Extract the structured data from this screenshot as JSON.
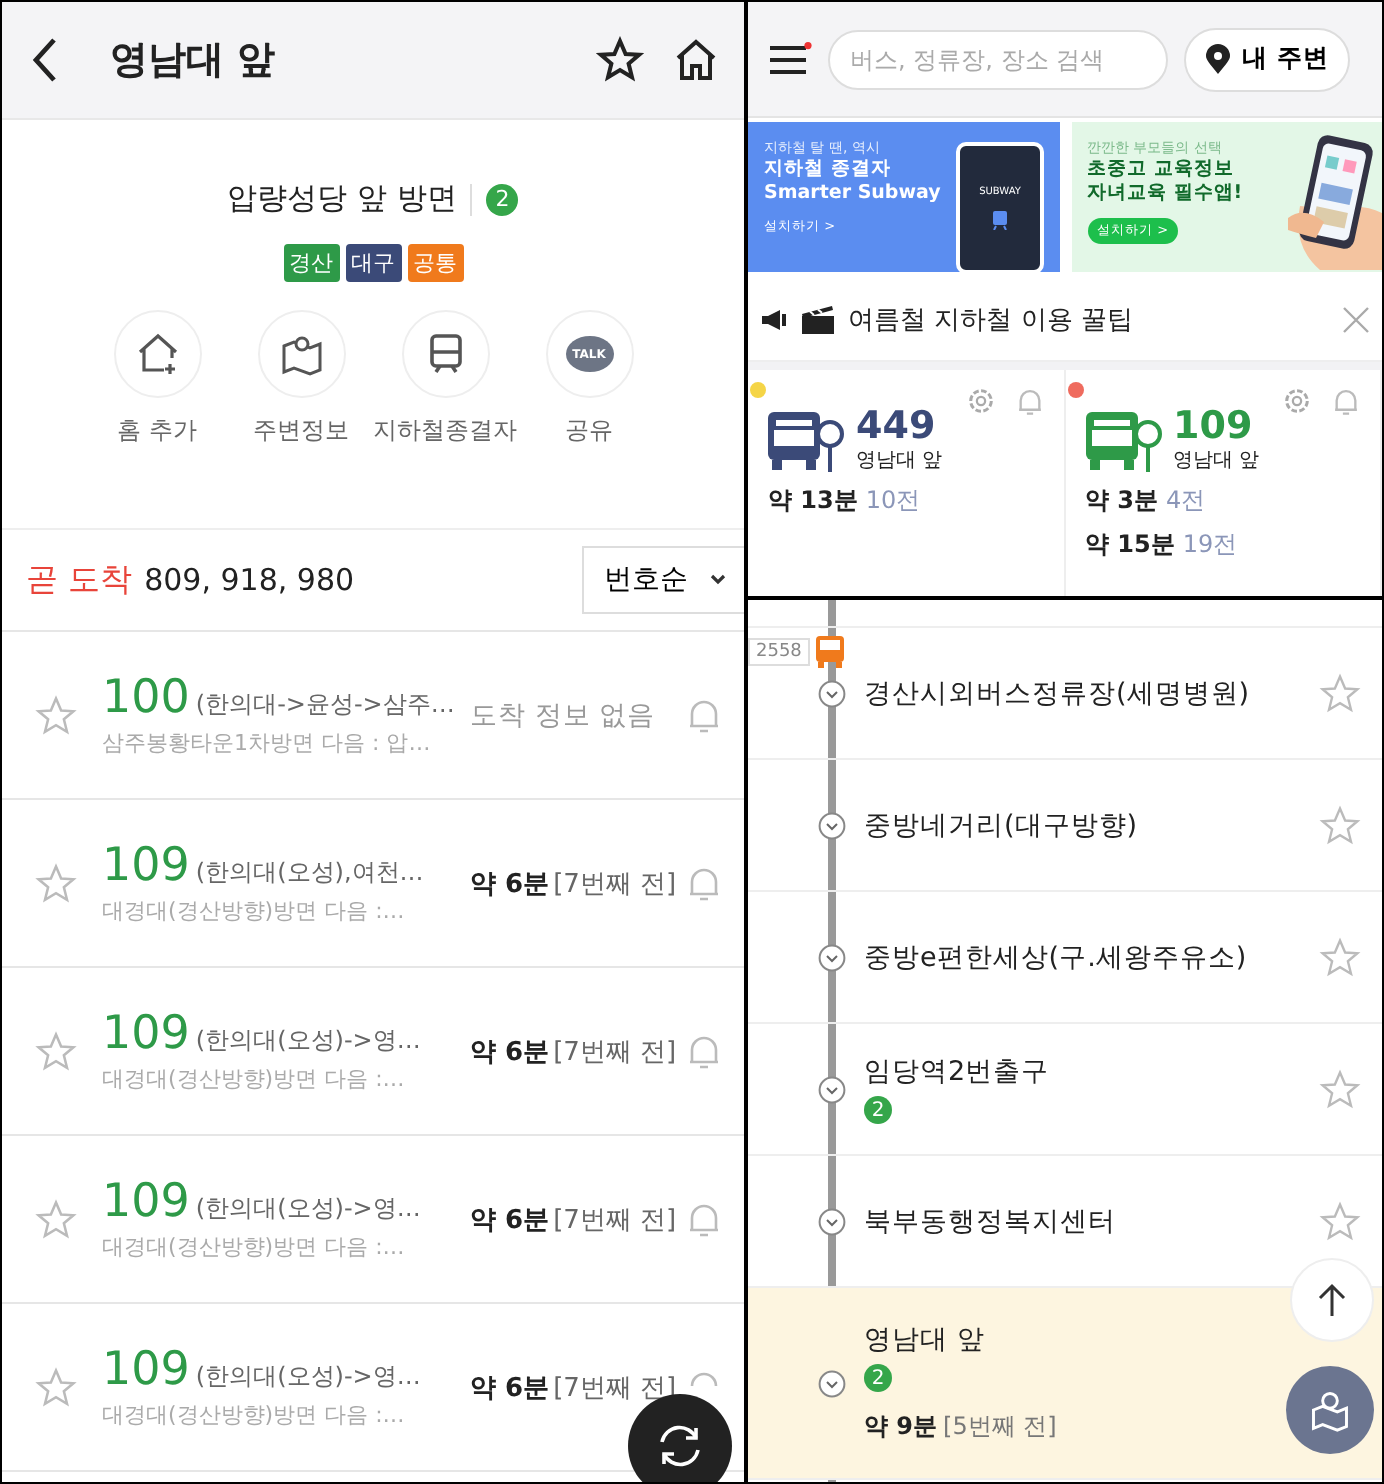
{
  "left": {
    "header": {
      "title": "영남대 앞"
    },
    "stop": {
      "direction": "압량성당 앞 방면",
      "line_badge": "2",
      "tags": [
        {
          "label": "경산",
          "color": "#2e9a48"
        },
        {
          "label": "대구",
          "color": "#3b4a78"
        },
        {
          "label": "공통",
          "color": "#f07a1c"
        }
      ]
    },
    "actions": [
      {
        "kind": "home",
        "label": "홈 추가"
      },
      {
        "kind": "map",
        "label": "주변정보"
      },
      {
        "kind": "subway",
        "label": "지하철종결자"
      },
      {
        "kind": "talk",
        "label": "공유",
        "icon_text": "TALK"
      }
    ],
    "arriving": {
      "label": "곧 도착",
      "routes": "809, 918, 980"
    },
    "sort": "번호순",
    "routes": [
      {
        "number": "100",
        "route": "(한의대->윤성->삼주…",
        "next": "삼주봉황타운1차방면 다음 : 압…",
        "status": "도착 정보 없음"
      },
      {
        "number": "109",
        "route": "(한의대(오성),여천…",
        "next": "대경대(경산방향)방면 다음 :…",
        "time": "약 6분",
        "order": "[7번째 전]"
      },
      {
        "number": "109",
        "route": "(한의대(오성)->영…",
        "next": "대경대(경산방향)방면 다음 :…",
        "time": "약 6분",
        "order": "[7번째 전]"
      },
      {
        "number": "109",
        "route": "(한의대(오성)->영…",
        "next": "대경대(경산방향)방면 다음 :…",
        "time": "약 6분",
        "order": "[7번째 전]"
      },
      {
        "number": "109",
        "route": "(한의대(오성)->영…",
        "next": "대경대(경산방향)방면 다음 :…",
        "time": "약 6분",
        "order": "[7번째 전]"
      }
    ]
  },
  "right_top": {
    "search": {
      "placeholder": "버스, 정류장, 장소 검색"
    },
    "nearby_button": "내 주변",
    "banners": [
      {
        "kind": "subway",
        "kicker": "지하철 탈 땐, 역시",
        "lines": [
          "지하철 종결자",
          "Smarter Subway"
        ],
        "cta": "설치하기 >",
        "screen_text": "SUBWAY"
      },
      {
        "kind": "education",
        "kicker": "깐깐한 부모들의 선택",
        "lines": [
          "초중고 교육정보",
          "자녀교육 필수앱!"
        ],
        "cta": "설치하기 >"
      }
    ],
    "notice": "여름철 지하철 이용 꿀팁",
    "favorites": [
      {
        "kind": "trunk",
        "color": "#f5d547",
        "number": "449",
        "stop": "영남대 앞",
        "arrivals": [
          {
            "time": "약 13분",
            "stops": "10전"
          }
        ]
      },
      {
        "kind": "local",
        "color": "#ef6b5e",
        "number": "109",
        "stop": "영남대 앞",
        "arrivals": [
          {
            "time": "약 3분",
            "stops": "4전"
          },
          {
            "time": "약 15분",
            "stops": "19전"
          }
        ]
      }
    ]
  },
  "right_bottom": {
    "bus": {
      "plate": "2558"
    },
    "stops": [
      {
        "name": "경산시외버스정류장(세명병원)",
        "current": false
      },
      {
        "name": "중방네거리(대구방향)",
        "current": false
      },
      {
        "name": "중방e편한세상(구.세왕주유소)",
        "current": false
      },
      {
        "name": "임당역2번출구",
        "subway": "2",
        "current": false
      },
      {
        "name": "북부동행정복지센터",
        "current": false
      },
      {
        "name": "영남대 앞",
        "subway": "2",
        "current": true,
        "time": "약 9분",
        "order": "[5번째 전]"
      }
    ]
  }
}
